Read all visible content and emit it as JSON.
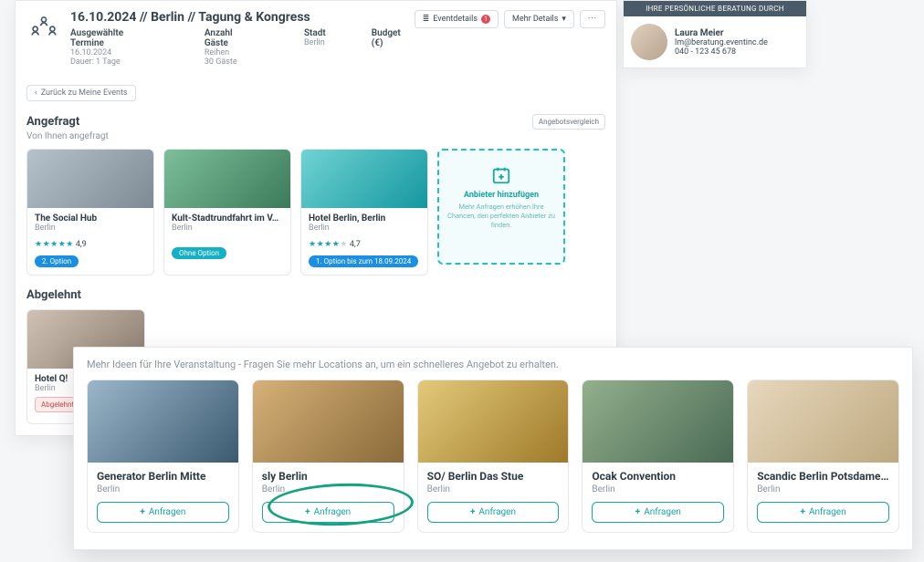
{
  "header": {
    "title": "16.10.2024 // Berlin // Tagung & Kongress",
    "meta": {
      "termine_label": "Ausgewählte Termine",
      "termine_date": "16.10.2024",
      "termine_duration": "Dauer: 1 Tage",
      "gaeste_label": "Anzahl Gäste",
      "gaeste_reihen": "Reihen",
      "gaeste_count": "30 Gäste",
      "stadt_label": "Stadt",
      "stadt_value": "Berlin",
      "budget_label": "Budget (€)"
    },
    "buttons": {
      "eventdetails": "Eventdetails",
      "eventdetails_badge": "1",
      "mehr": "Mehr Details",
      "more_icon": "···"
    }
  },
  "breadcrumb": {
    "back_label": "Zurück zu Meine Events"
  },
  "sections": {
    "angefragt_title": "Angefragt",
    "vergleich_btn": "Angebotsvergleich",
    "angefragt_sub": "Von Ihnen angefragt",
    "abgelehnt_title": "Abgelehnt"
  },
  "requested": [
    {
      "name": "The Social Hub",
      "city": "Berlin",
      "stars": 5,
      "rating": "4,9",
      "chip": "2. Option",
      "chip_class": "chip-blue"
    },
    {
      "name": "Kult-Stadtrundfahrt im V…",
      "city": "Berlin",
      "stars": 0,
      "rating": "",
      "chip": "Ohne Option",
      "chip_class": "chip-teal"
    },
    {
      "name": "Hotel Berlin, Berlin",
      "city": "Berlin",
      "stars": 4,
      "rating": "4,7",
      "chip": "1. Option bis zum 18.09.2024",
      "chip_class": "chip-blue"
    }
  ],
  "add_card": {
    "title": "Anbieter hinzufügen",
    "sub": "Mehr Anfragen erhöhen Ihre Chancen, den perfekten Anbieter zu finden."
  },
  "rejected": {
    "name": "Hotel Q!",
    "city": "Berlin",
    "badge": "Abgelehnt durch Anbieter"
  },
  "contact": {
    "header": "IHRE PERSÖNLICHE BERATUNG DURCH",
    "name": "Laura Meier",
    "email": "lm@beratung.eventinc.de",
    "phone": "040 - 123 45 678"
  },
  "front": {
    "caption": "Mehr Ideen für Ihre Veranstaltung - Fragen Sie mehr Locations an, um ein schnelleres Angebot zu erhalten.",
    "action_label": "Anfragen",
    "items": [
      {
        "name": "Generator Berlin Mitte",
        "city": "Berlin"
      },
      {
        "name": "sly Berlin",
        "city": "Berlin"
      },
      {
        "name": "SO/ Berlin Das Stue",
        "city": "Berlin"
      },
      {
        "name": "Ocak Convention",
        "city": "Berlin"
      },
      {
        "name": "Scandic Berlin Potsdamer …",
        "city": "Berlin"
      }
    ]
  }
}
